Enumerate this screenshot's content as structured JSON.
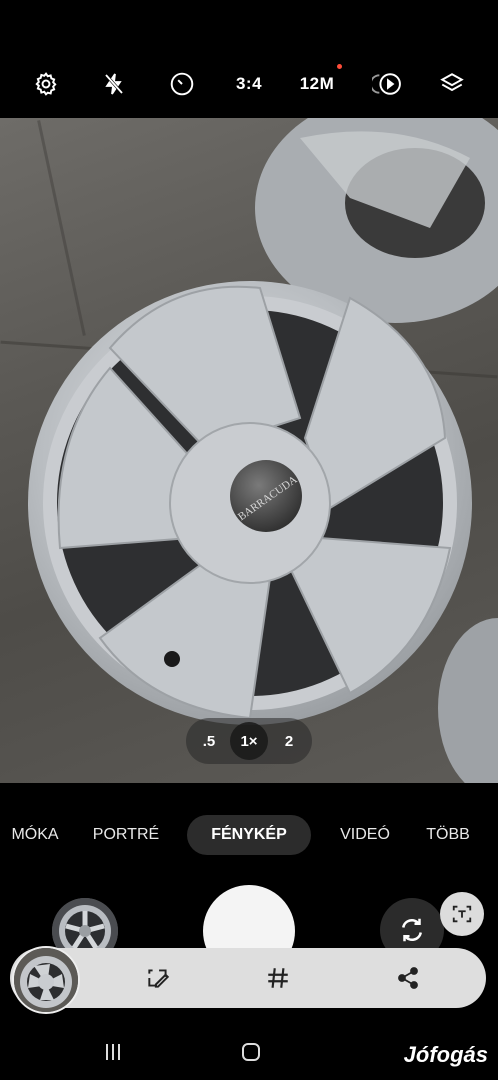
{
  "top_bar": {
    "settings_icon": "gear-icon",
    "flash_icon": "flash-off-icon",
    "timer_icon": "timer-icon",
    "aspect_ratio": "3:4",
    "resolution": "12M",
    "motion_photo_icon": "motion-photo-icon",
    "filters_icon": "layers-icon",
    "notification_dot_color": "#ff4d3a"
  },
  "zoom": {
    "options": [
      ".5",
      "1×",
      "2"
    ],
    "selected": "1×"
  },
  "modes": {
    "items": [
      "MÓKA",
      "PORTRÉ",
      "FÉNYKÉP",
      "VIDEÓ",
      "TÖBB"
    ],
    "active": "FÉNYKÉP"
  },
  "controls": {
    "shutter_icon": "shutter-button",
    "flip_icon": "camera-flip-icon",
    "lens_icon": "scan-text-icon"
  },
  "action_bar": {
    "edit_icon": "edit-icon",
    "tag_icon": "hashtag-icon",
    "share_icon": "share-icon"
  },
  "nav": {
    "recents_icon": "recents-icon",
    "home_icon": "home-icon"
  },
  "watermark": "Jófogás"
}
